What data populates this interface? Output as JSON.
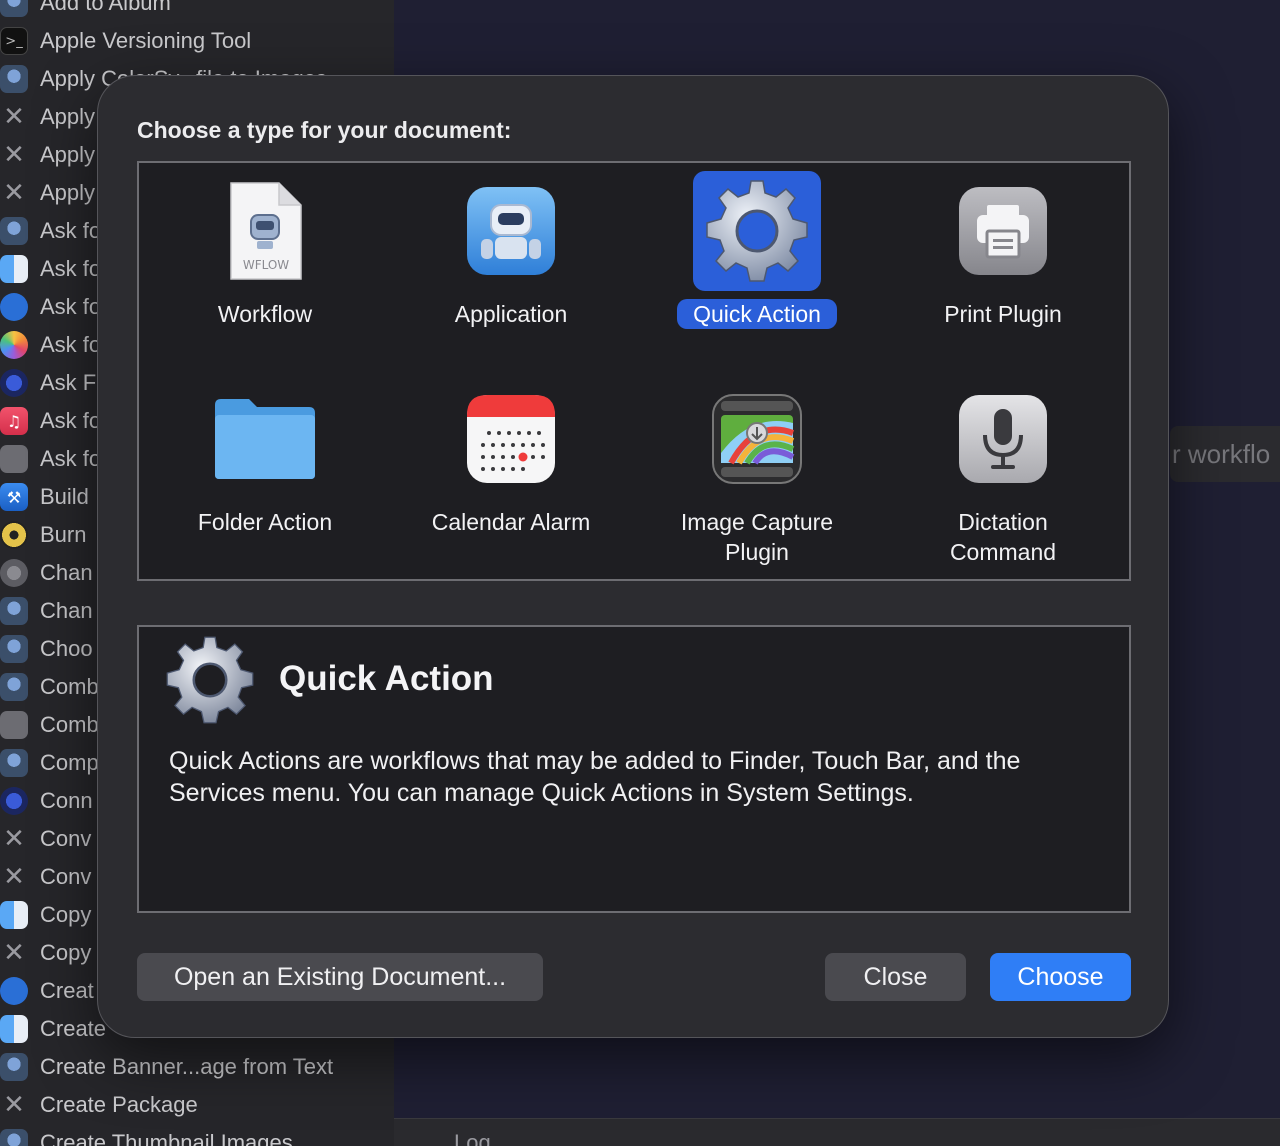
{
  "background": {
    "library_items": [
      {
        "label": "Add to Album",
        "icon": "automator-icon"
      },
      {
        "label": "Apple Versioning Tool",
        "icon": "terminal-icon"
      },
      {
        "label": "Apply ColorSy...file to Images",
        "icon": "automator-icon"
      },
      {
        "label": "Apply",
        "icon": "tools-icon"
      },
      {
        "label": "Apply",
        "icon": "tools-icon"
      },
      {
        "label": "Apply",
        "icon": "tools-icon"
      },
      {
        "label": "Ask fo",
        "icon": "automator-icon"
      },
      {
        "label": "Ask fo",
        "icon": "finder-icon"
      },
      {
        "label": "Ask fo",
        "icon": "quicktime-icon"
      },
      {
        "label": "Ask fo",
        "icon": "photos-icon"
      },
      {
        "label": "Ask F",
        "icon": "network-icon"
      },
      {
        "label": "Ask fo",
        "icon": "music-icon"
      },
      {
        "label": "Ask fo",
        "icon": "generic-icon"
      },
      {
        "label": "Build",
        "icon": "xcode-icon"
      },
      {
        "label": "Burn",
        "icon": "burn-icon"
      },
      {
        "label": "Chan",
        "icon": "system-icon"
      },
      {
        "label": "Chan",
        "icon": "automator-icon"
      },
      {
        "label": "Choo",
        "icon": "automator-icon"
      },
      {
        "label": "Comb",
        "icon": "automator-icon"
      },
      {
        "label": "Comb",
        "icon": "generic-icon"
      },
      {
        "label": "Comp",
        "icon": "automator-icon"
      },
      {
        "label": "Conn",
        "icon": "network-icon"
      },
      {
        "label": "Conv",
        "icon": "tools-icon"
      },
      {
        "label": "Conv",
        "icon": "tools-icon"
      },
      {
        "label": "Copy",
        "icon": "finder-icon"
      },
      {
        "label": "Copy",
        "icon": "tools-icon"
      },
      {
        "label": "Creat",
        "icon": "quicktime-icon"
      },
      {
        "label": "Create",
        "icon": "finder-icon"
      },
      {
        "label": "Create Banner...age from Text",
        "icon": "automator-icon"
      },
      {
        "label": "Create Package",
        "icon": "tools-icon"
      },
      {
        "label": "Create Thumbnail Images",
        "icon": "automator-icon"
      }
    ],
    "editor_hint": "r workflo",
    "log_label": "Log"
  },
  "dialog": {
    "title": "Choose a type for your document:",
    "types": [
      {
        "label": "Workflow",
        "icon": "workflow-document-icon",
        "badge": "WFLOW",
        "selected": false
      },
      {
        "label": "Application",
        "icon": "application-robot-icon",
        "selected": false
      },
      {
        "label": "Quick Action",
        "icon": "gear-icon",
        "selected": true
      },
      {
        "label": "Print Plugin",
        "icon": "printer-icon",
        "selected": false
      },
      {
        "label": "Folder Action",
        "icon": "folder-icon",
        "selected": false
      },
      {
        "label": "Calendar Alarm",
        "icon": "calendar-icon",
        "selected": false
      },
      {
        "label": "Image Capture\nPlugin",
        "icon": "image-capture-icon",
        "selected": false
      },
      {
        "label": "Dictation\nCommand",
        "icon": "microphone-icon",
        "selected": false
      }
    ],
    "description": {
      "title": "Quick Action",
      "icon": "gear-icon",
      "text": "Quick Actions are workflows that may be added to Finder, Touch Bar, and the Services menu. You can manage Quick Actions in System Settings."
    },
    "buttons": {
      "open_existing": "Open an Existing Document...",
      "close": "Close",
      "choose": "Choose"
    }
  }
}
